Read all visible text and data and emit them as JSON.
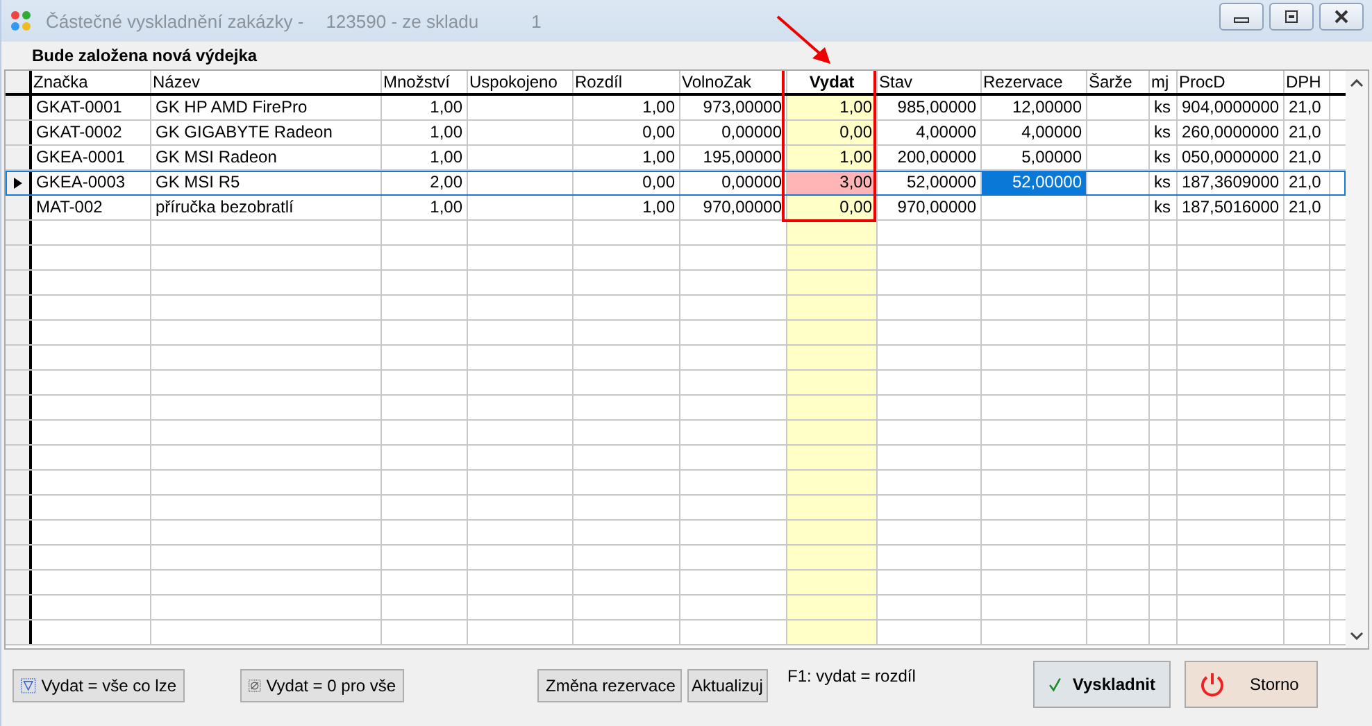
{
  "window": {
    "title": "Částečné vyskladnění zakázky -",
    "order": "123590 - ze skladu",
    "count": "1"
  },
  "heading": "Bude založena nová výdejka",
  "table": {
    "columns": [
      "Značka",
      "Název",
      "Množství",
      "Uspokojeno",
      "Rozdíl",
      "VolnoZak",
      "Vydat",
      "Stav",
      "Rezervace",
      "Šarže",
      "mj",
      "ProcD",
      "DPH"
    ],
    "rows": [
      {
        "selected": false,
        "vydat_exceeded": false,
        "rezervace_focused": false,
        "cells": [
          "GKAT-0001",
          "GK HP AMD FirePro",
          "1,00",
          "",
          "1,00",
          "973,00000",
          "1,00",
          "985,00000",
          "12,00000",
          "",
          "ks",
          "904,0000000",
          "21,0"
        ]
      },
      {
        "selected": false,
        "vydat_exceeded": false,
        "rezervace_focused": false,
        "cells": [
          "GKAT-0002",
          "GK  GIGABYTE Radeon",
          "1,00",
          "",
          "0,00",
          "0,00000",
          "0,00",
          "4,00000",
          "4,00000",
          "",
          "ks",
          "260,0000000",
          "21,0"
        ]
      },
      {
        "selected": false,
        "vydat_exceeded": false,
        "rezervace_focused": false,
        "cells": [
          "GKEA-0001",
          "GK MSI  Radeon",
          "1,00",
          "",
          "1,00",
          "195,00000",
          "1,00",
          "200,00000",
          "5,00000",
          "",
          "ks",
          "050,0000000",
          "21,0"
        ]
      },
      {
        "selected": true,
        "vydat_exceeded": true,
        "rezervace_focused": true,
        "cells": [
          "GKEA-0003",
          "GK MSI R5",
          "2,00",
          "",
          "0,00",
          "0,00000",
          "3,00",
          "52,00000",
          "52,00000",
          "",
          "ks",
          "187,3609000",
          "21,0"
        ]
      },
      {
        "selected": false,
        "vydat_exceeded": false,
        "rezervace_focused": false,
        "cells": [
          "MAT-002",
          "příručka bezobratlí",
          "1,00",
          "",
          "1,00",
          "970,00000",
          "0,00",
          "970,00000",
          "",
          "",
          "ks",
          "187,5016000",
          "21,0"
        ]
      }
    ]
  },
  "footer": {
    "buttons": [
      "Vydat = vše co lze",
      "Vydat = 0 pro vše",
      "Změna rezervace",
      "Aktualizuj"
    ],
    "hint": "F1: vydat = rozdíl",
    "confirm": "Vyskladnit",
    "cancel": "Storno"
  }
}
